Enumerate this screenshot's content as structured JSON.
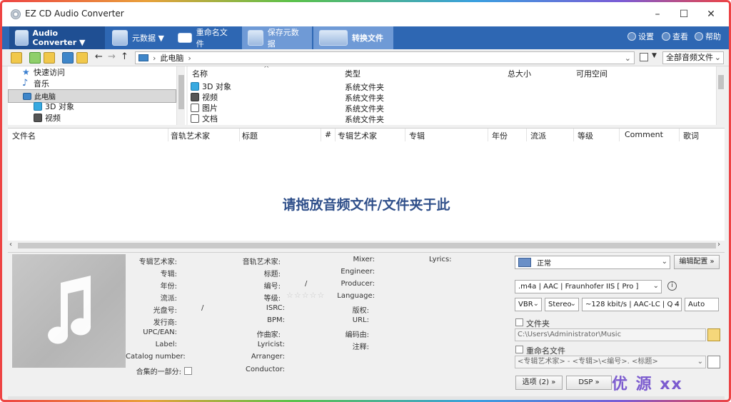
{
  "window": {
    "title": "EZ CD Audio Converter"
  },
  "ribbon": {
    "tabs": [
      "Audio Converter ▼",
      "元数据 ▼",
      "重命名文件",
      "保存元数据",
      "转换文件"
    ],
    "right": [
      "设置",
      "查看",
      "帮助"
    ]
  },
  "nav": {
    "path": "此电脑",
    "filter": "全部音频文件"
  },
  "tree": {
    "items": [
      "快速访问",
      "音乐",
      "此电脑",
      "3D 对象",
      "视频"
    ]
  },
  "files": {
    "headers": [
      "名称",
      "类型",
      "总大小",
      "可用空间"
    ],
    "rows": [
      {
        "name": "3D 对象",
        "type": "系统文件夹"
      },
      {
        "name": "视频",
        "type": "系统文件夹"
      },
      {
        "name": "图片",
        "type": "系统文件夹"
      },
      {
        "name": "文档",
        "type": "系统文件夹"
      }
    ]
  },
  "grid": {
    "headers": [
      "文件名",
      "音轨艺术家",
      "标题",
      "#",
      "专辑艺术家",
      "专辑",
      "年份",
      "流派",
      "等级",
      "Comment",
      "歌词"
    ],
    "drop_hint": "请拖放音频文件/文件夹于此"
  },
  "meta": {
    "col1": [
      "专辑艺术家:",
      "专辑:",
      "年份:",
      "流派:",
      "光盘号:",
      "发行商:",
      "UPC/EAN:",
      "Label:",
      "Catalog number:",
      "合集的一部分:"
    ],
    "disc_sep": "/",
    "col2": [
      "音轨艺术家:",
      "标题:",
      "编号:",
      "等级:",
      "ISRC:",
      "BPM:",
      "作曲家:",
      "Lyricist:",
      "Arranger:",
      "Conductor:"
    ],
    "track_sep": "/",
    "stars": "☆☆☆☆☆",
    "col3": [
      "Mixer:",
      "Engineer:",
      "Producer:",
      "Language:",
      "版权:",
      "URL:",
      "编码由:",
      "注释:"
    ],
    "lyrics": "Lyrics:"
  },
  "output": {
    "profile": "正常",
    "edit_profile": "编辑配置 »",
    "format": ".m4a | AAC | Fraunhofer IIS [ Pro ]",
    "mode": "VBR",
    "channels": "Stereo",
    "quality": "~128 kbit/s | AAC-LC | Q 4",
    "auto": "Auto",
    "folder_label": "文件夹",
    "folder_path": "C:\\Users\\Administrator\\Music",
    "rename_label": "重命名文件",
    "rename_pattern": "<专辑艺术家> - <专辑>\\<编号>. <标题>",
    "options": "选项 (2) »",
    "dsp": "DSP »"
  },
  "watermark": "优 源 xx"
}
